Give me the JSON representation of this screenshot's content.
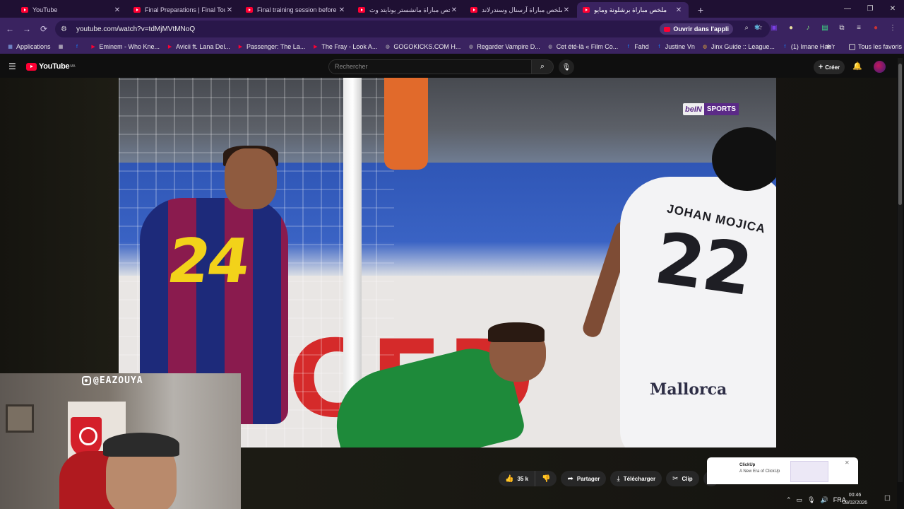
{
  "browser": {
    "tabs": [
      {
        "title": "YouTube",
        "active": false
      },
      {
        "title": "Final Preparations | Final Touch",
        "active": false
      },
      {
        "title": "Final training session before th",
        "active": false
      },
      {
        "title": "ملخص مباراة مانشستر يونايتد وت",
        "active": false
      },
      {
        "title": "ملخص مباراة آرسنال وسندرلاند (:",
        "active": false
      },
      {
        "title": "ملخص مباراة برشلونة ومايو",
        "active": true
      }
    ],
    "close_glyph": "✕",
    "new_tab_glyph": "+",
    "window_controls": [
      "—",
      "❐",
      "✕"
    ],
    "nav": {
      "back": "←",
      "forward": "→",
      "reload": "⟳"
    },
    "url": "youtube.com/watch?v=tdMjMVtMNoQ",
    "open_app_label": "Ouvrir dans l'appli",
    "bookmarks": [
      {
        "label": "Applications",
        "icon": "grid-icon",
        "color": "#8ab4f8"
      },
      {
        "label": "",
        "icon": "grid-icon",
        "color": "#dddddd"
      },
      {
        "label": "",
        "icon": "facebook-icon",
        "color": "#1877f2"
      },
      {
        "label": "Eminem - Who Kne...",
        "icon": "youtube-icon",
        "color": "#ff0033"
      },
      {
        "label": "Avicii ft. Lana Del...",
        "icon": "youtube-icon",
        "color": "#ff0033"
      },
      {
        "label": "Passenger: The La...",
        "icon": "youtube-icon",
        "color": "#ff0033"
      },
      {
        "label": "The Fray - Look A...",
        "icon": "youtube-icon",
        "color": "#ff0033"
      },
      {
        "label": "GOGOKICKS.COM H...",
        "icon": "globe-icon",
        "color": "#bbbbbb"
      },
      {
        "label": "Regarder Vampire D...",
        "icon": "globe-icon",
        "color": "#bbbbbb"
      },
      {
        "label": "Cet été-là « Film Co...",
        "icon": "globe-icon",
        "color": "#bbbbbb"
      },
      {
        "label": "Fahd",
        "icon": "facebook-icon",
        "color": "#1877f2"
      },
      {
        "label": "Justine Vn",
        "icon": "facebook-icon",
        "color": "#1877f2"
      },
      {
        "label": "Jinx Guide :: League...",
        "icon": "globe-icon",
        "color": "#e0a43a"
      },
      {
        "label": "(1) Imane Hab'r",
        "icon": "facebook-icon",
        "color": "#1877f2"
      }
    ],
    "bookmarks_more": "»",
    "all_bookmarks": "Tous les favoris"
  },
  "youtube": {
    "logo_text": "YouTube",
    "logo_region": "MA",
    "search_placeholder": "Rechercher",
    "create_label": "Créer",
    "video": {
      "broadcaster_part1": "beIN",
      "broadcaster_part2": "SPORTS",
      "player_left_number": "24",
      "player_right_number": "22",
      "player_right_name": "JOHAN MOJICA",
      "sponsor": "Mallorca",
      "board_text": "CED"
    },
    "webcam_handle": "EAZOUYA",
    "actions": {
      "likes": "35 k",
      "share": "Partager",
      "download": "Télécharger",
      "clip": "Clip",
      "more": "···"
    },
    "ad": {
      "line1": "ClickUp",
      "line2": "A New Era of ClickUp"
    }
  },
  "taskbar": {
    "language": "FRA",
    "time": "00:46",
    "date": "08/02/2026"
  },
  "colors": {
    "tab_strip": "#1f1033",
    "toolbar": "#3a2360",
    "youtube_red": "#ff0033",
    "page_bg": "#0f0f0f"
  }
}
